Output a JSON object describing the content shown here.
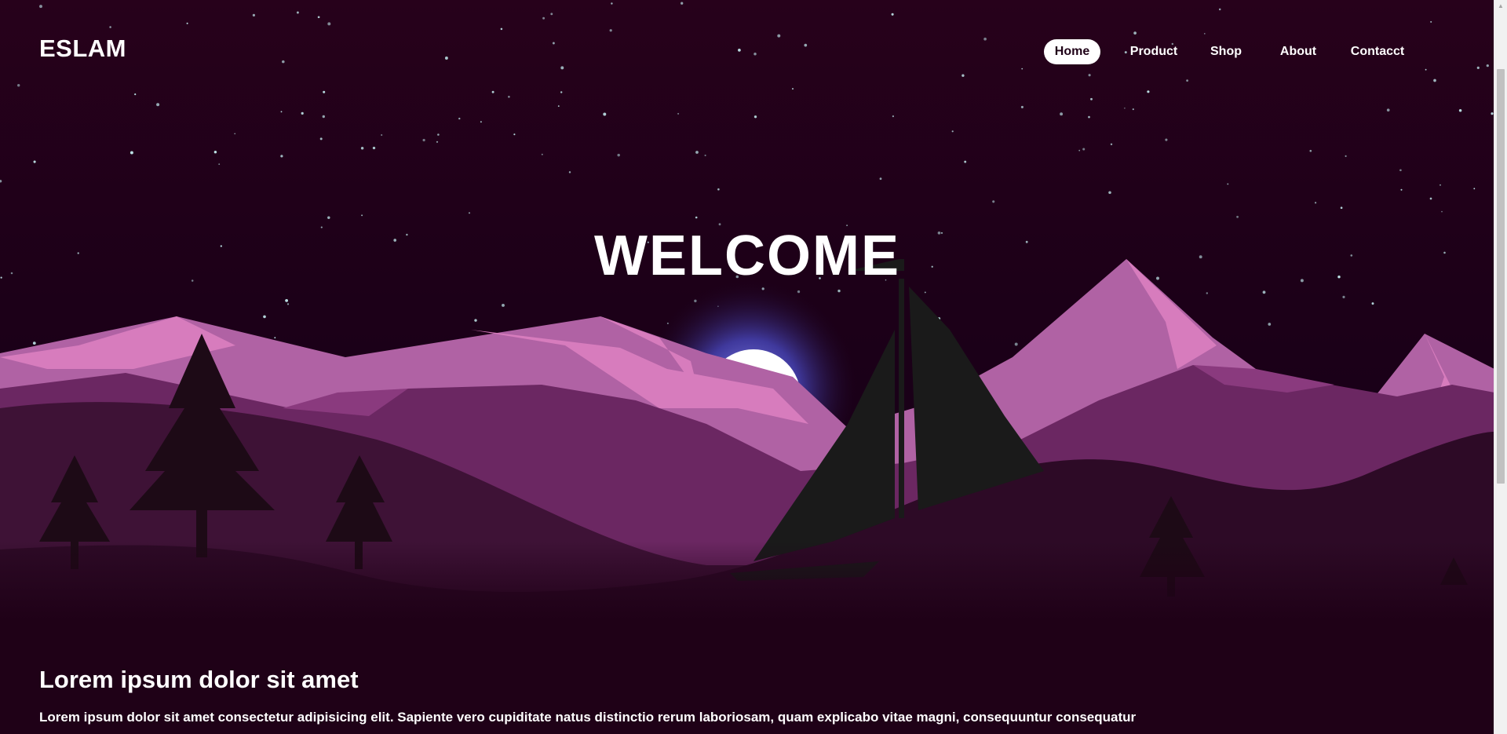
{
  "header": {
    "logo": "ESLAM",
    "nav": [
      {
        "label": "Home",
        "active": true
      },
      {
        "label": "Product",
        "active": false
      },
      {
        "label": "Shop",
        "active": false
      },
      {
        "label": "About",
        "active": false
      },
      {
        "label": "Contacct",
        "active": false
      }
    ]
  },
  "hero": {
    "title": "WELCOME",
    "scene": "night sky with stars, moon, purple mountains, pine trees and a sailboat"
  },
  "content": {
    "heading": "Lorem ipsum dolor sit amet",
    "paragraph": "Lorem ipsum dolor sit amet consectetur adipisicing elit. Sapiente vero cupiditate natus distinctio rerum laboriosam, quam explicabo vitae magni, consequuntur consequatur"
  },
  "colors": {
    "background": "#1f0117",
    "sky_top": "#27011b",
    "mountain_far": "#b062a4",
    "mountain_peak": "#d77cbd",
    "mountain_mid": "#6b2762",
    "hill_dark": "#2d0a26",
    "tree": "#1d0a16",
    "sail": "#1a1a1a",
    "moon": "#ffffff",
    "moon_glow": "#6a6be0",
    "nav_active_bg": "#ffffff",
    "nav_active_text": "#1f0117"
  }
}
